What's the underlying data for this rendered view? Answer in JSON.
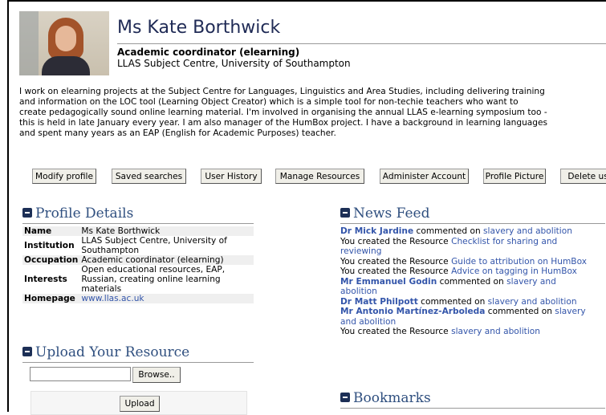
{
  "profile": {
    "name": "Ms Kate Borthwick",
    "occupation": "Academic coordinator (elearning)",
    "institution": "LLAS Subject Centre, University of Southampton",
    "bio": "I work on elearning projects at the Subject Centre for Languages, Linguistics and Area Studies, including delivering training\nand information on the LOC tool (Learning Object Creator) which is a simple tool for non-techie teachers who want to\ncreate pedagogically sound online learning material. I'm involved in organising the annual LLAS e-learning symposium too -\nthis is held in late January every year. I am also manager of the HumBox project. I have a background in learning languages\nand spent many years as an EAP (English for Academic Purposes) teacher."
  },
  "buttons": {
    "modify_profile": "Modify profile",
    "saved_searches": "Saved searches",
    "user_history": "User History",
    "manage_resources": "Manage Resources",
    "administer_account": "Administer Account",
    "profile_picture": "Profile Picture",
    "delete_user": "Delete user"
  },
  "profile_details": {
    "title": "Profile Details",
    "rows": [
      {
        "label": "Name",
        "value": "Ms Kate Borthwick"
      },
      {
        "label": "Institution",
        "value": "LLAS Subject Centre, University of Southampton"
      },
      {
        "label": "Occupation",
        "value": "Academic coordinator (elearning)"
      },
      {
        "label": "Interests",
        "value": "Open educational resources, EAP, Russian, creating online learning materials"
      },
      {
        "label": "Homepage",
        "value": "www.llas.ac.uk"
      }
    ]
  },
  "upload": {
    "title": "Upload Your Resource",
    "browse_label": "Browse..",
    "upload_label": "Upload"
  },
  "news_feed": {
    "title": "News Feed",
    "entries": [
      {
        "actor": "Dr Mick Jardine",
        "verb": " commented on ",
        "link": "slavery and abolition"
      },
      {
        "actor": "",
        "verb": "You created the Resource ",
        "link": "Checklist for sharing and reviewing"
      },
      {
        "actor": "",
        "verb": "You created the Resource ",
        "link": "Guide to attribution on HumBox"
      },
      {
        "actor": "",
        "verb": "You created the Resource ",
        "link": "Advice on tagging in HumBox"
      },
      {
        "actor": "Mr Emmanuel Godin",
        "verb": " commented on ",
        "link": "slavery and abolition"
      },
      {
        "actor": "Dr Matt Philpott",
        "verb": " commented on ",
        "link": "slavery and abolition"
      },
      {
        "actor": "Mr Antonio Martínez-Arboleda",
        "verb": " commented on ",
        "link": "slavery and abolition"
      },
      {
        "actor": "",
        "verb": "You created the Resource ",
        "link": "slavery and abolition"
      }
    ]
  },
  "bookmarks": {
    "title": "Bookmarks"
  }
}
